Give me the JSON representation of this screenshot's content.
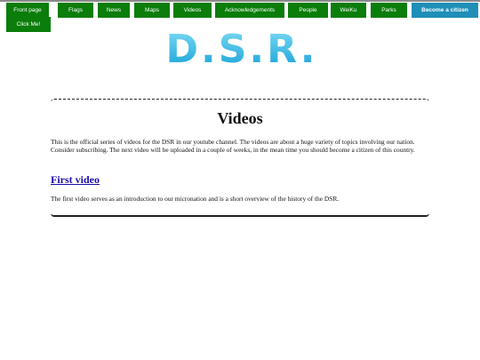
{
  "nav": {
    "items": [
      {
        "label": "Front page"
      },
      {
        "label": "Flags"
      },
      {
        "label": "News"
      },
      {
        "label": "Maps"
      },
      {
        "label": "Videos"
      },
      {
        "label": "Acknowledgements"
      },
      {
        "label": "People"
      },
      {
        "label": "WeiKu"
      },
      {
        "label": "Parks"
      }
    ],
    "cta_label": "Become a citizen",
    "click_label": "Click Me!",
    "colors": {
      "button": "#0a7d0a",
      "cta": "#1f8fb8",
      "text": "#ffffff"
    }
  },
  "logo": {
    "text": "D.S.R.",
    "colors": {
      "light": "#6fd4f2",
      "dark": "#1aa6d8"
    }
  },
  "content": {
    "title": "Videos",
    "intro": "This is the official series of videos for the DSR in our youtube channel. The videos are about a huge variety of topics involving our nation. Consider subscribing. The next video will be uploaded in a couple of weeks, in the mean time you should become a citizen of this country.",
    "section_title": "First video",
    "section_text": "The first video serves as an introduction to our micronation and is a short overview of the history of the DSR."
  }
}
